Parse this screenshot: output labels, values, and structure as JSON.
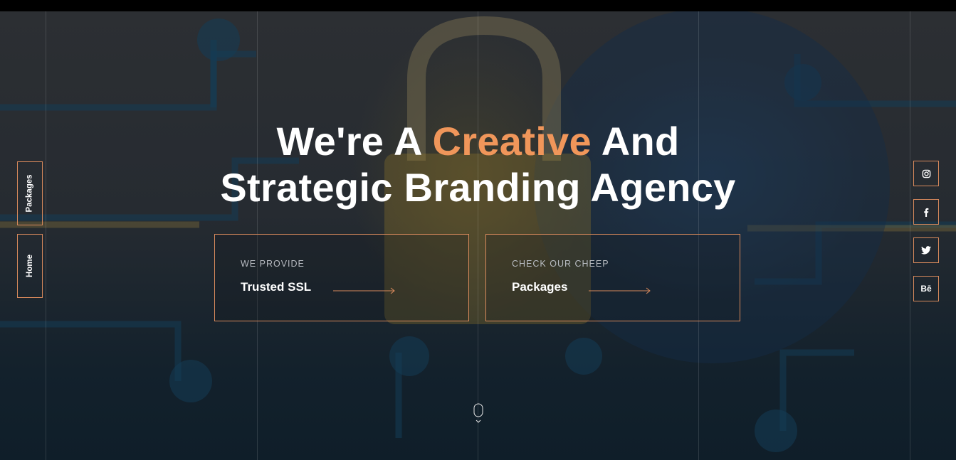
{
  "headline": {
    "line1_before": "We're A ",
    "line1_accent": "Creative",
    "line1_after": " And",
    "line2": "Strategic Branding Agency"
  },
  "cards": [
    {
      "kicker": "WE PROVIDE",
      "title": "Trusted SSL"
    },
    {
      "kicker": "CHECK OUR CHEEP",
      "title": "Packages"
    }
  ],
  "side_nav": [
    {
      "label": "Packages"
    },
    {
      "label": "Home"
    }
  ],
  "social": [
    {
      "icon": "instagram-icon"
    },
    {
      "icon": "facebook-icon"
    },
    {
      "icon": "twitter-icon"
    },
    {
      "icon": "behance-icon",
      "glyph": "Bē"
    }
  ],
  "colors": {
    "accent": "#f0965a",
    "border": "#d98a5c",
    "topbar": "#000000"
  }
}
